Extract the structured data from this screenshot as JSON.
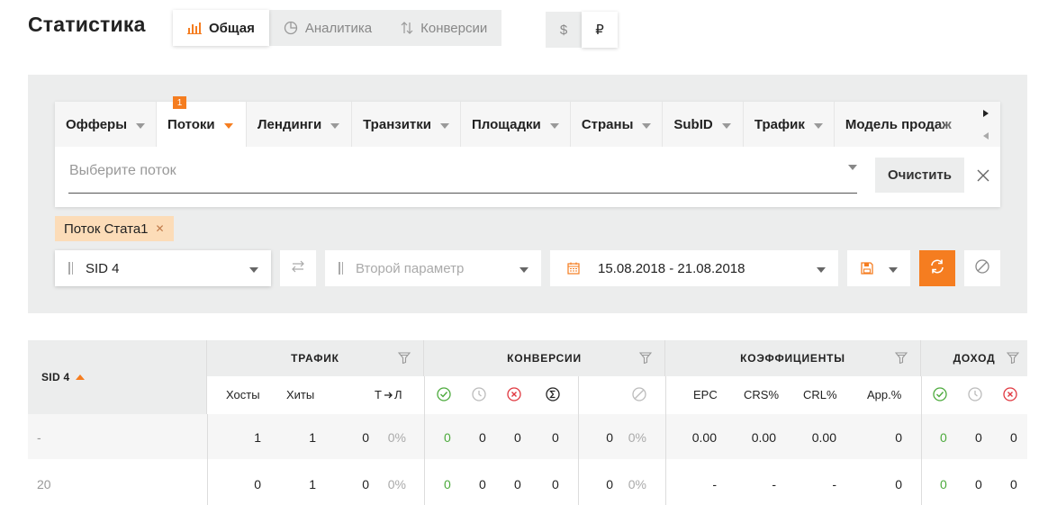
{
  "header": {
    "title": "Статистика",
    "view_tabs": [
      {
        "label": "Общая",
        "active": true,
        "icon": "bar-chart-icon"
      },
      {
        "label": "Аналитика",
        "active": false,
        "icon": "pie-chart-icon"
      },
      {
        "label": "Конверсии",
        "active": false,
        "icon": "sort-arrows-icon"
      }
    ],
    "currency_tabs": [
      {
        "label": "$",
        "active": false
      },
      {
        "label": "₽",
        "active": true
      }
    ]
  },
  "filters": {
    "tabs": [
      {
        "label": "Офферы",
        "active": false
      },
      {
        "label": "Потоки",
        "active": true,
        "badge": "1"
      },
      {
        "label": "Лендинги",
        "active": false
      },
      {
        "label": "Транзитки",
        "active": false
      },
      {
        "label": "Площадки",
        "active": false
      },
      {
        "label": "Страны",
        "active": false
      },
      {
        "label": "SubID",
        "active": false
      },
      {
        "label": "Трафик",
        "active": false
      },
      {
        "label": "Модель продаж",
        "active": false
      }
    ],
    "select_placeholder": "Выберите поток",
    "clear_label": "Очистить",
    "chips": [
      {
        "label": "Поток Стата1"
      }
    ]
  },
  "controls": {
    "group_by": "SID 4",
    "second_param_placeholder": "Второй параметр",
    "date_range": "15.08.2018 - 21.08.2018"
  },
  "colors": {
    "accent": "#f57d20",
    "green": "#4caa3c",
    "red": "#e0373f"
  },
  "table": {
    "first_col": "SID 4",
    "groups": [
      {
        "label": "ТРАФИК"
      },
      {
        "label": "КОНВЕРСИИ"
      },
      {
        "label": "КОЭФФИЦИЕНТЫ"
      },
      {
        "label": "ДОХОД"
      }
    ],
    "sub_headers": {
      "hosts": "Хосты",
      "hits": "Хиты",
      "tl": "Т",
      "tl2": "Л",
      "epc": "EPC",
      "crs": "CRS%",
      "crl": "CRL%",
      "app": "App.%"
    },
    "rows": [
      {
        "sid": "-",
        "hosts": "1",
        "hits": "1",
        "tl": "0",
        "tlp": "0%",
        "c_ok": "0",
        "c_wait": "0",
        "c_rej": "0",
        "c_sum": "0",
        "c_tr": "0",
        "c_trp": "0%",
        "epc": "0.00",
        "crs": "0.00",
        "crl": "0.00",
        "app": "0",
        "d_ok": "0",
        "d_wait": "0",
        "d_rej": "0"
      },
      {
        "sid": "20",
        "hosts": "0",
        "hits": "1",
        "tl": "0",
        "tlp": "0%",
        "c_ok": "0",
        "c_wait": "0",
        "c_rej": "0",
        "c_sum": "0",
        "c_tr": "0",
        "c_trp": "0%",
        "epc": "-",
        "crs": "-",
        "crl": "-",
        "app": "0",
        "d_ok": "0",
        "d_wait": "0",
        "d_rej": "0"
      }
    ]
  }
}
